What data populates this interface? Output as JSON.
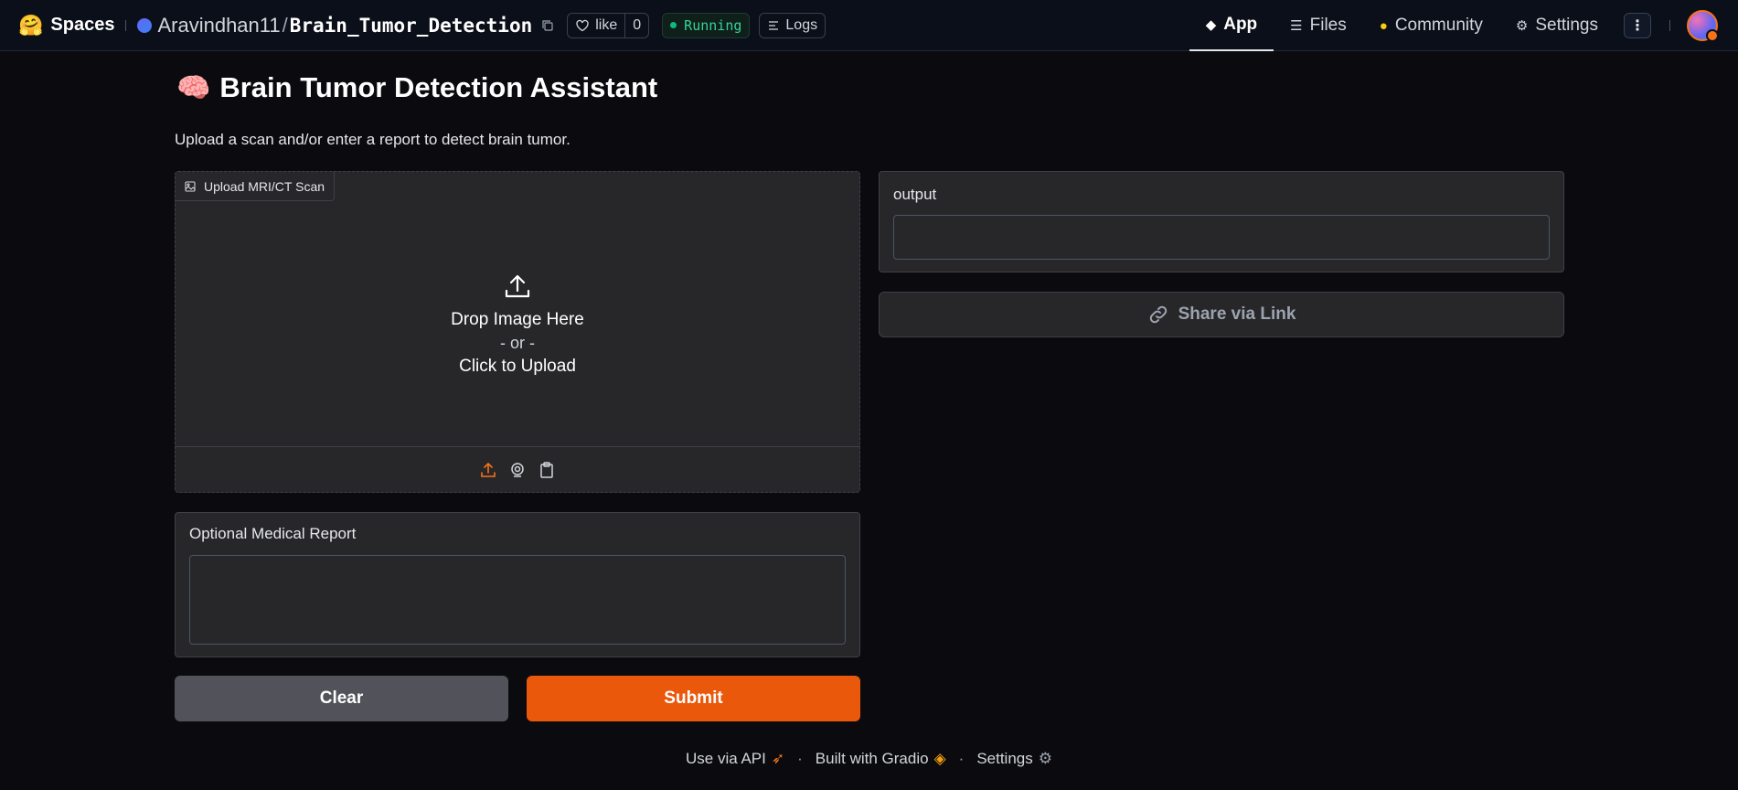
{
  "nav": {
    "brand": "Spaces",
    "owner": "Aravindhan11",
    "separator": "/",
    "repo_name": "Brain_Tumor_Detection",
    "like_label": "like",
    "like_count": "0",
    "status": "Running",
    "logs_label": "Logs",
    "tabs": [
      {
        "label": "App",
        "icon": "cube-icon",
        "active": true
      },
      {
        "label": "Files",
        "icon": "files-icon",
        "active": false
      },
      {
        "label": "Community",
        "icon": "community-icon",
        "active": false
      },
      {
        "label": "Settings",
        "icon": "gear-icon",
        "active": false
      }
    ],
    "accent_color": "#f97316"
  },
  "main": {
    "title_emoji": "🧠",
    "title": "Brain Tumor Detection Assistant",
    "description": "Upload a scan and/or enter a report to detect brain tumor.",
    "upload": {
      "label": "Upload MRI/CT Scan",
      "drop_text": "Drop Image Here",
      "or_text": "- or -",
      "click_text": "Click to Upload"
    },
    "report": {
      "label": "Optional Medical Report",
      "value": ""
    },
    "buttons": {
      "clear": "Clear",
      "submit": "Submit",
      "submit_color": "#ea580c"
    },
    "output": {
      "label": "output",
      "value": ""
    },
    "share": "Share via Link"
  },
  "footer": {
    "api": "Use via API",
    "built": "Built with Gradio",
    "settings": "Settings",
    "dot": "·"
  }
}
